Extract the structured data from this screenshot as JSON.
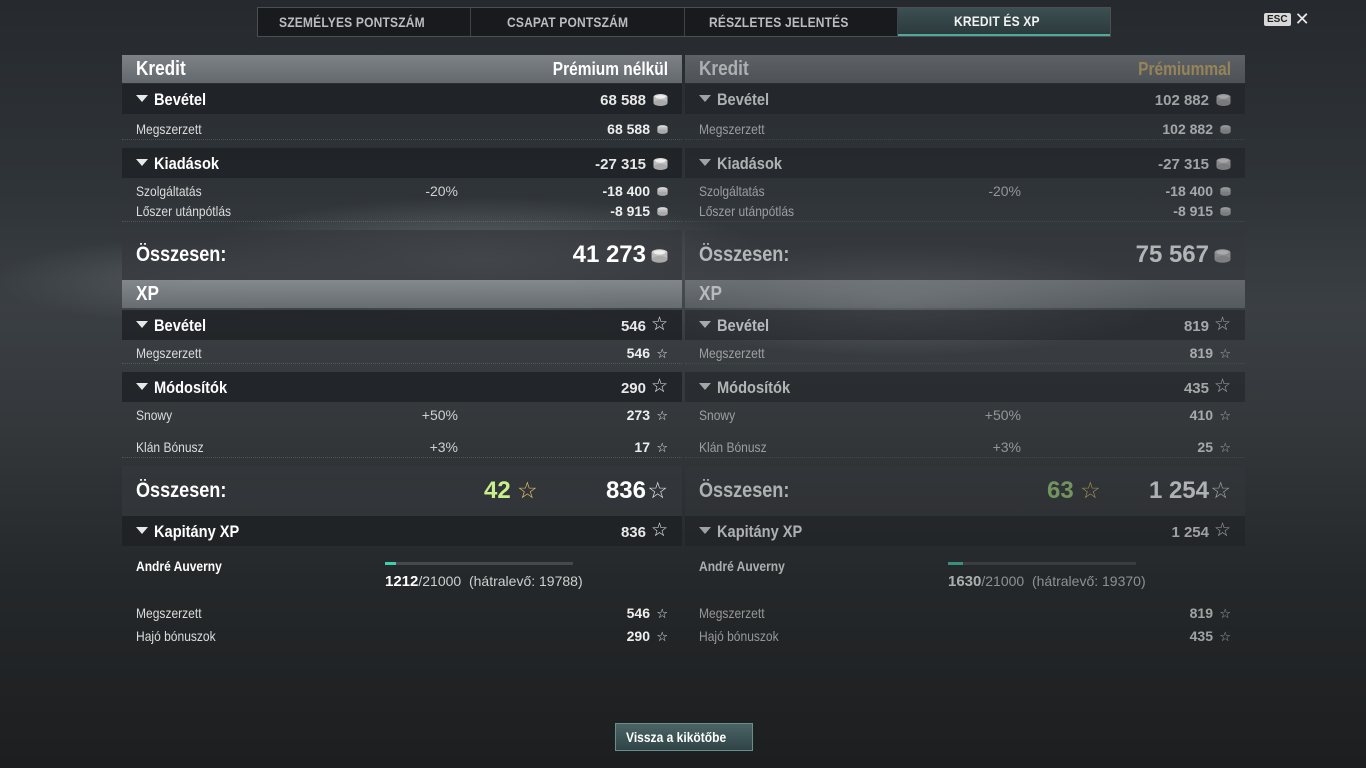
{
  "tabs": [
    {
      "label": "SZEMÉLYES PONTSZÁM",
      "active": false
    },
    {
      "label": "CSAPAT PONTSZÁM",
      "active": false
    },
    {
      "label": "RÉSZLETES JELENTÉS",
      "active": false
    },
    {
      "label": "KREDIT ÉS XP",
      "active": true
    }
  ],
  "esc_label": "ESC",
  "close_symbol": "✕",
  "panels": [
    {
      "credit_title": "Kredit",
      "mode_label": "Prémium nélkül",
      "income": {
        "label": "Bevétel",
        "value": "68 588",
        "rows": [
          {
            "label": "Megszerzett",
            "value": "68 588"
          }
        ]
      },
      "expenses": {
        "label": "Kiadások",
        "value": "-27 315",
        "rows": [
          {
            "label": "Szolgáltatás",
            "pct": "-20%",
            "value": "-18 400"
          },
          {
            "label": "Lőszer utánpótlás",
            "pct": "",
            "value": "-8 915"
          }
        ]
      },
      "credit_total": {
        "label": "Összesen:",
        "value": "41 273"
      },
      "xp_title": "XP",
      "xp_income": {
        "label": "Bevétel",
        "value": "546",
        "rows": [
          {
            "label": "Megszerzett",
            "value": "546"
          }
        ]
      },
      "modifiers": {
        "label": "Módosítók",
        "value": "290",
        "rows": [
          {
            "label": "Snowy",
            "pct": "+50%",
            "value": "273"
          },
          {
            "label": "Klán Bónusz",
            "pct": "+3%",
            "value": "17"
          }
        ]
      },
      "xp_total": {
        "label": "Összesen:",
        "bonus": "42",
        "value": "836"
      },
      "captain": {
        "label": "Kapitány XP",
        "value": "836",
        "name": "André Auverny",
        "current": "1212",
        "slash": "/",
        "max": "21000",
        "remaining": "(hátralevő: 19788)",
        "progress": 0.0577,
        "rows": [
          {
            "label": "Megszerzett",
            "value": "546"
          },
          {
            "label": "Hajó bónuszok",
            "value": "290"
          }
        ]
      }
    },
    {
      "credit_title": "Kredit",
      "mode_label": "Prémiummal",
      "income": {
        "label": "Bevétel",
        "value": "102 882",
        "rows": [
          {
            "label": "Megszerzett",
            "value": "102 882"
          }
        ]
      },
      "expenses": {
        "label": "Kiadások",
        "value": "-27 315",
        "rows": [
          {
            "label": "Szolgáltatás",
            "pct": "-20%",
            "value": "-18 400"
          },
          {
            "label": "Lőszer utánpótlás",
            "pct": "",
            "value": "-8 915"
          }
        ]
      },
      "credit_total": {
        "label": "Összesen:",
        "value": "75 567"
      },
      "xp_title": "XP",
      "xp_income": {
        "label": "Bevétel",
        "value": "819",
        "rows": [
          {
            "label": "Megszerzett",
            "value": "819"
          }
        ]
      },
      "modifiers": {
        "label": "Módosítók",
        "value": "435",
        "rows": [
          {
            "label": "Snowy",
            "pct": "+50%",
            "value": "410"
          },
          {
            "label": "Klán Bónusz",
            "pct": "+3%",
            "value": "25"
          }
        ]
      },
      "xp_total": {
        "label": "Összesen:",
        "bonus": "63",
        "value": "1 254"
      },
      "captain": {
        "label": "Kapitány XP",
        "value": "1 254",
        "name": "André Auverny",
        "current": "1630",
        "slash": "/",
        "max": "21000",
        "remaining": "(hátralevő: 19370)",
        "progress": 0.0776,
        "rows": [
          {
            "label": "Megszerzett",
            "value": "819"
          },
          {
            "label": "Hajó bónuszok",
            "value": "435"
          }
        ]
      }
    }
  ],
  "back_button": "Vissza a kikötőbe",
  "icons": {
    "credit": "credit-coin-icon",
    "xp": "xp-star-icon",
    "bonus": "bonus-xp-star-icon"
  },
  "colors": {
    "accent": "#4fa89a",
    "bonus_xp": "#c9ee8c",
    "premium": "#d9b970"
  }
}
